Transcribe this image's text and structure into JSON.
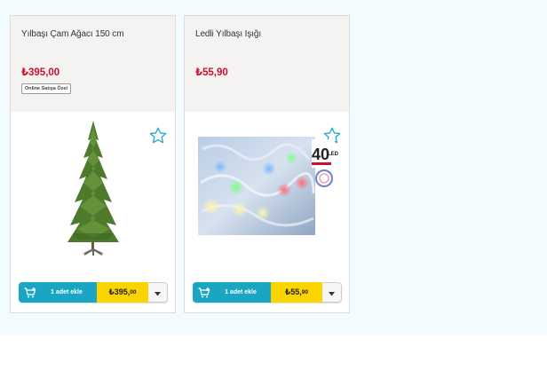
{
  "products": [
    {
      "title": "Yılbaşı Çam Ağacı 150 cm",
      "price": "₺395,00",
      "badge": "Online Satışa Özel",
      "add_label": "1 adet ekle",
      "button_price_main": "₺395,",
      "button_price_dec": "00"
    },
    {
      "title": "Ledli Yılbaşı Işığı",
      "price": "₺55,90",
      "add_label": "1 adet ekle",
      "button_price_main": "₺55,",
      "button_price_dec": "90",
      "package_label_number": "40",
      "package_label_text": "LED"
    }
  ],
  "icons": {
    "favorite": "star-outline-icon",
    "cart": "cart-plus-icon",
    "dropdown": "chevron-down-icon"
  },
  "colors": {
    "price_red": "#c8102e",
    "add_button_teal": "#1aa6c3",
    "price_button_yellow": "#fbd400",
    "card_header_bg": "#f5f3f1",
    "page_bg": "#f2fbfd"
  }
}
